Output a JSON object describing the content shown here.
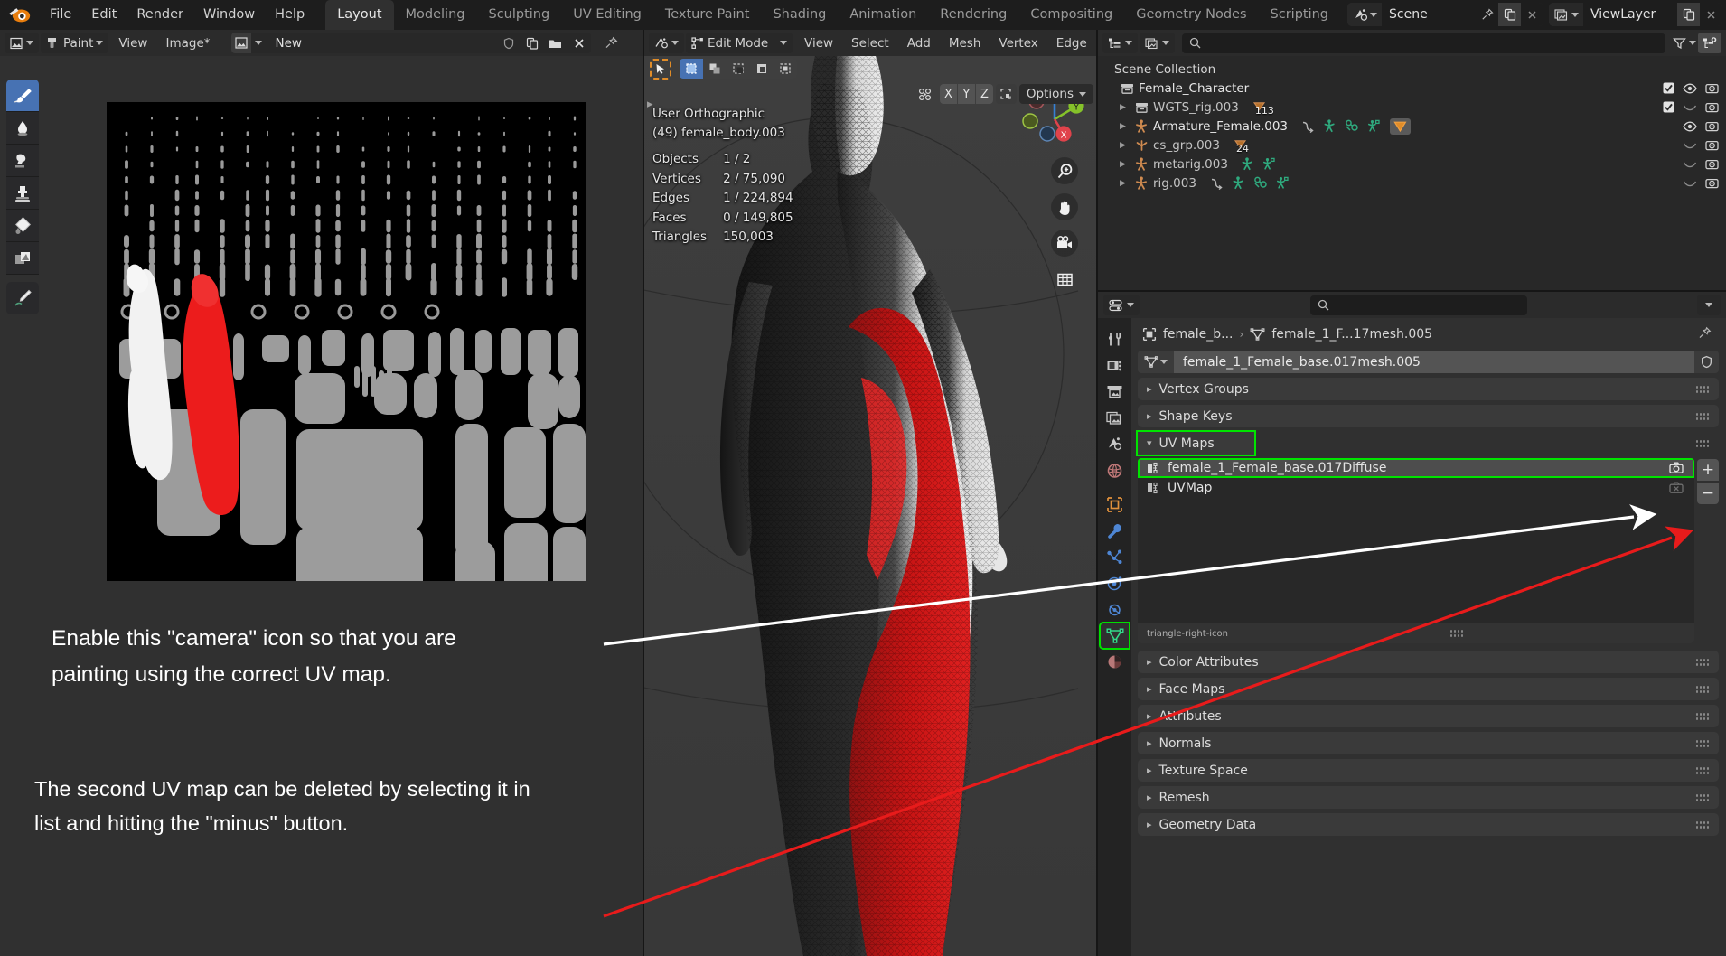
{
  "app": {
    "logo_icon": "blender-logo-icon",
    "menus": [
      "File",
      "Edit",
      "Render",
      "Window",
      "Help"
    ],
    "workspace_tabs": [
      {
        "label": "Layout",
        "active": true
      },
      {
        "label": "Modeling",
        "active": false
      },
      {
        "label": "Sculpting",
        "active": false
      },
      {
        "label": "UV Editing",
        "active": false
      },
      {
        "label": "Texture Paint",
        "active": false
      },
      {
        "label": "Shading",
        "active": false
      },
      {
        "label": "Animation",
        "active": false
      },
      {
        "label": "Rendering",
        "active": false
      },
      {
        "label": "Compositing",
        "active": false
      },
      {
        "label": "Geometry Nodes",
        "active": false
      },
      {
        "label": "Scripting",
        "active": false
      }
    ],
    "add_workspace_label": "+",
    "scene": {
      "icon": "scene-icon",
      "name": "Scene",
      "pin_icon": "pin-icon",
      "copy_icon": "new-copy-icon",
      "close_icon": "unlink-x-icon"
    },
    "view_layer": {
      "icon": "viewlayer-icon",
      "name": "ViewLayer",
      "copy_icon": "new-copy-icon",
      "close_icon": "unlink-x-icon"
    }
  },
  "image_editor": {
    "editor_type_icon": "image-editor-icon",
    "mode": "Paint",
    "menus": [
      "View",
      "Image*"
    ],
    "image_datablock": {
      "browse_icon": "browse-image-icon",
      "name": "New",
      "fake_user_icon": "shield-icon",
      "new_icon": "duplicate-icon",
      "open_icon": "folder-icon",
      "unlink_icon": "x-icon",
      "pin_icon": "pin-icon"
    },
    "tools": [
      {
        "name": "draw-brush-tool",
        "icon": "paint-brush-icon",
        "active": true
      },
      {
        "name": "soften-tool",
        "icon": "water-drop-icon",
        "active": false
      },
      {
        "name": "smear-tool",
        "icon": "smear-icon",
        "active": false
      },
      {
        "name": "clone-tool",
        "icon": "clone-stamp-icon",
        "active": false
      },
      {
        "name": "fill-tool",
        "icon": "paint-bucket-icon",
        "active": false
      },
      {
        "name": "mask-tool",
        "icon": "mask-icon",
        "active": false
      },
      {
        "name": "annotate-tool",
        "icon": "pencil-annotate-icon",
        "active": false
      }
    ],
    "uv_texture_alt": "UV layout texture map of character body parts on black background"
  },
  "annotations": {
    "note_1": "Enable this \"camera\" icon so that you are\npainting using the correct UV map.",
    "note_2": "The second UV map can be deleted by selecting it in\nlist and hitting the \"minus\" button.",
    "arrow_white_color": "#ffffff",
    "arrow_red_color": "#e81b1b",
    "highlight_color": "#00e400"
  },
  "viewport": {
    "editor_type_icon": "3d-viewport-icon",
    "mode_selector": {
      "icon": "edit-mode-icon",
      "label": "Edit Mode"
    },
    "mesh_select_modes": [
      {
        "name": "vertex-select-mode",
        "active": false
      },
      {
        "name": "edge-select-mode",
        "active": true
      },
      {
        "name": "face-select-mode",
        "active": false
      }
    ],
    "menus": [
      "View",
      "Select",
      "Add",
      "Mesh",
      "Vertex",
      "Edge"
    ],
    "tweak_tool_icon": "tweak-cursor-icon",
    "select_modes": [
      {
        "name": "select-box",
        "active": true
      },
      {
        "name": "select-circle",
        "active": false
      },
      {
        "name": "select-lasso",
        "active": false
      },
      {
        "name": "select-extend",
        "active": false
      },
      {
        "name": "select-intersect",
        "active": false
      }
    ],
    "proportional_edit_icon": "proportional-editing-icon",
    "axis_locks": [
      "X",
      "Y",
      "Z"
    ],
    "snap_icon": "snap-icon",
    "options_label": "Options",
    "stats": {
      "view_name": "User Orthographic",
      "active_object": "(49) female_body.003",
      "rows": [
        {
          "label": "Objects",
          "value": "1 / 2"
        },
        {
          "label": "Vertices",
          "value": "2 / 75,090"
        },
        {
          "label": "Edges",
          "value": "1 / 224,894"
        },
        {
          "label": "Faces",
          "value": "0 / 149,805"
        },
        {
          "label": "Triangles",
          "value": "150,003"
        }
      ]
    },
    "gizmo": {
      "x_label": "X",
      "y_label": "Y",
      "z_label": "Z",
      "x_color": "#e0434b",
      "y_color": "#85c22a",
      "z_color": "#3580d4"
    },
    "nav_buttons": [
      {
        "name": "zoom-button",
        "icon": "zoom-magnifier-icon"
      },
      {
        "name": "pan-button",
        "icon": "hand-pan-icon"
      },
      {
        "name": "camera-view-button",
        "icon": "movie-camera-icon"
      },
      {
        "name": "toggle-ortho-button",
        "icon": "grid-perspective-icon"
      }
    ]
  },
  "outliner": {
    "display_mode_icon": "outliner-display-mode-icon",
    "filter_id_icon": "scene-data-icon",
    "search_placeholder": "",
    "search_icon": "search-icon",
    "filter_icon": "funnel-filter-icon",
    "new_collection_icon": "new-collection-icon",
    "root_label": "Scene Collection",
    "rows": [
      {
        "label": "Female_Character",
        "icon": "collection-icon",
        "indent": 0,
        "expandable": false,
        "bright": true,
        "badges": [],
        "checkbox": true,
        "eye": "open",
        "camera": true
      },
      {
        "label": "WGTS_rig.003",
        "icon": "collection-icon",
        "indent": 1,
        "expandable": true,
        "bright": false,
        "badges": [
          {
            "type": "mesh-data-count",
            "count": "113"
          }
        ],
        "checkbox": true,
        "eye": "closed",
        "camera": true
      },
      {
        "label": "Armature_Female.003",
        "icon": "armature-icon",
        "indent": 1,
        "expandable": true,
        "bright": true,
        "badges": [
          {
            "type": "child-link-icon"
          },
          {
            "type": "pose-icon"
          },
          {
            "type": "modifier-icon"
          },
          {
            "type": "armature-data-icon"
          },
          {
            "type": "mesh-data-icon",
            "highlighted": true
          }
        ],
        "checkbox": null,
        "eye": "open",
        "camera": true
      },
      {
        "label": "cs_grp.003",
        "icon": "empty-axis-icon",
        "indent": 1,
        "expandable": true,
        "bright": false,
        "badges": [
          {
            "type": "mesh-data-count",
            "count": "24"
          }
        ],
        "checkbox": null,
        "eye": "closed",
        "camera": true
      },
      {
        "label": "metarig.003",
        "icon": "armature-icon",
        "indent": 1,
        "expandable": true,
        "bright": false,
        "badges": [
          {
            "type": "pose-icon"
          },
          {
            "type": "armature-data-icon"
          }
        ],
        "checkbox": null,
        "eye": "closed",
        "camera": true
      },
      {
        "label": "rig.003",
        "icon": "armature-icon",
        "indent": 1,
        "expandable": true,
        "bright": false,
        "badges": [
          {
            "type": "child-link-icon"
          },
          {
            "type": "pose-icon"
          },
          {
            "type": "modifier-icon"
          },
          {
            "type": "armature-data-icon"
          }
        ],
        "checkbox": null,
        "eye": "closed",
        "camera": true
      }
    ]
  },
  "properties": {
    "editor_type_icon": "properties-editor-icon",
    "search_placeholder": "",
    "search_icon": "search-icon",
    "options_caret_icon": "chevron-down-icon",
    "tabs": [
      {
        "name": "tool",
        "icon": "tool-screwdriver-wrench-icon",
        "selected": false
      },
      {
        "name": "render",
        "icon": "render-camera-back-icon",
        "selected": false
      },
      {
        "name": "output",
        "icon": "output-printer-icon",
        "selected": false
      },
      {
        "name": "view-layer",
        "icon": "view-layer-images-icon",
        "selected": false
      },
      {
        "name": "scene",
        "icon": "scene-cone-icon",
        "selected": false
      },
      {
        "name": "world",
        "icon": "world-globe-icon",
        "selected": false
      },
      {
        "name": "object",
        "icon": "object-square-icon",
        "selected": false
      },
      {
        "name": "modifiers",
        "icon": "wrench-icon",
        "selected": false
      },
      {
        "name": "particles",
        "icon": "particles-icon",
        "selected": false
      },
      {
        "name": "physics",
        "icon": "physics-orbit-icon",
        "selected": false
      },
      {
        "name": "constraints",
        "icon": "constraints-icon",
        "selected": false
      },
      {
        "name": "object-data",
        "icon": "mesh-data-triangle-icon",
        "selected": true
      },
      {
        "name": "material",
        "icon": "material-sphere-icon",
        "selected": false
      }
    ],
    "breadcrumb": {
      "object_icon": "object-square-icon",
      "object": "female_b...",
      "sep": "›",
      "data_icon": "mesh-data-triangle-icon",
      "data": "female_1_F...17mesh.005",
      "pin_icon": "pin-icon"
    },
    "datablock": {
      "browse_icon": "mesh-data-triangle-icon",
      "name": "female_1_Female_base.017mesh.005",
      "fake_user_icon": "shield-icon"
    },
    "panels": [
      {
        "label": "Vertex Groups",
        "open": false,
        "highlight": false
      },
      {
        "label": "Shape Keys",
        "open": false,
        "highlight": false
      },
      {
        "label": "UV Maps",
        "open": true,
        "highlight": true
      },
      {
        "label": "Color Attributes",
        "open": false,
        "highlight": false
      },
      {
        "label": "Face Maps",
        "open": false,
        "highlight": false
      },
      {
        "label": "Attributes",
        "open": false,
        "highlight": false
      },
      {
        "label": "Normals",
        "open": false,
        "highlight": false
      },
      {
        "label": "Texture Space",
        "open": false,
        "highlight": false
      },
      {
        "label": "Remesh",
        "open": false,
        "highlight": false
      },
      {
        "label": "Geometry Data",
        "open": false,
        "highlight": false
      }
    ],
    "uv_maps": {
      "items": [
        {
          "name": "female_1_Female_base.017Diffuse",
          "icon": "uv-group-icon",
          "selected": true,
          "camera_icon": "camera-active-render-icon",
          "camera_on": true,
          "highlighted": true
        },
        {
          "name": "UVMap",
          "icon": "uv-group-icon",
          "selected": false,
          "camera_icon": "camera-inactive-render-icon",
          "camera_on": false,
          "highlighted": false
        }
      ],
      "add_button_label": "+",
      "remove_button_label": "−",
      "expand_arrow_icon": "triangle-right-icon"
    }
  }
}
